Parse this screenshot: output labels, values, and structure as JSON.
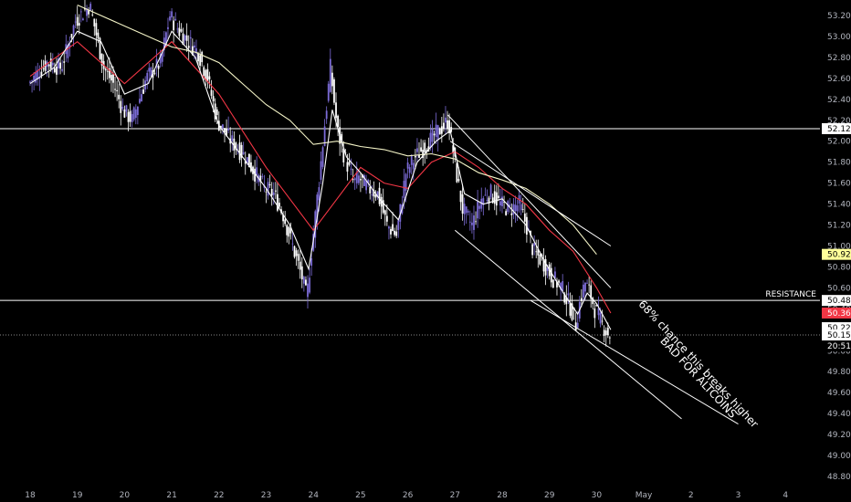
{
  "chart_data": {
    "type": "line",
    "title": "",
    "xlabel": "",
    "ylabel": "",
    "ylim": [
      48.7,
      53.34
    ],
    "x_ticks": [
      "18",
      "19",
      "20",
      "21",
      "22",
      "23",
      "24",
      "25",
      "26",
      "27",
      "28",
      "29",
      "30",
      "May",
      "2",
      "3",
      "4"
    ],
    "y_ticks": [
      "53.20",
      "53.00",
      "52.80",
      "52.60",
      "52.40",
      "52.20",
      "52.00",
      "51.80",
      "51.60",
      "51.40",
      "51.20",
      "51.00",
      "50.80",
      "50.60",
      "50.40",
      "50.20",
      "50.00",
      "49.80",
      "49.60",
      "49.40",
      "49.20",
      "49.00",
      "48.80"
    ],
    "price_path": [
      [
        18.0,
        52.55
      ],
      [
        18.4,
        52.75
      ],
      [
        18.7,
        52.7
      ],
      [
        19.0,
        53.15
      ],
      [
        19.3,
        53.3
      ],
      [
        19.6,
        52.7
      ],
      [
        19.8,
        52.55
      ],
      [
        20.0,
        52.3
      ],
      [
        20.2,
        52.2
      ],
      [
        20.5,
        52.6
      ],
      [
        20.8,
        52.75
      ],
      [
        21.0,
        53.2
      ],
      [
        21.2,
        53.05
      ],
      [
        21.4,
        52.95
      ],
      [
        21.6,
        52.85
      ],
      [
        21.8,
        52.6
      ],
      [
        22.0,
        52.2
      ],
      [
        22.3,
        52.0
      ],
      [
        22.6,
        51.85
      ],
      [
        22.8,
        51.7
      ],
      [
        23.0,
        51.55
      ],
      [
        23.2,
        51.5
      ],
      [
        23.4,
        51.3
      ],
      [
        23.6,
        51.0
      ],
      [
        23.8,
        50.7
      ],
      [
        23.9,
        50.5
      ],
      [
        24.0,
        50.95
      ],
      [
        24.2,
        51.8
      ],
      [
        24.4,
        52.7
      ],
      [
        24.55,
        52.1
      ],
      [
        24.7,
        51.85
      ],
      [
        24.9,
        51.6
      ],
      [
        25.0,
        51.65
      ],
      [
        25.2,
        51.55
      ],
      [
        25.4,
        51.5
      ],
      [
        25.6,
        51.2
      ],
      [
        25.8,
        51.1
      ],
      [
        26.0,
        51.7
      ],
      [
        26.2,
        51.85
      ],
      [
        26.4,
        51.95
      ],
      [
        26.6,
        52.05
      ],
      [
        26.8,
        52.15
      ],
      [
        26.9,
        52.2
      ],
      [
        27.05,
        51.75
      ],
      [
        27.2,
        51.35
      ],
      [
        27.4,
        51.2
      ],
      [
        27.6,
        51.45
      ],
      [
        27.8,
        51.5
      ],
      [
        28.0,
        51.4
      ],
      [
        28.2,
        51.35
      ],
      [
        28.4,
        51.4
      ],
      [
        28.55,
        51.2
      ],
      [
        28.7,
        50.95
      ],
      [
        28.9,
        50.85
      ],
      [
        29.1,
        50.7
      ],
      [
        29.3,
        50.6
      ],
      [
        29.5,
        50.4
      ],
      [
        29.6,
        50.25
      ],
      [
        29.7,
        50.5
      ],
      [
        29.8,
        50.65
      ],
      [
        29.9,
        50.55
      ],
      [
        30.0,
        50.4
      ],
      [
        30.1,
        50.3
      ],
      [
        30.2,
        50.22
      ],
      [
        30.3,
        50.15
      ]
    ],
    "series": [
      {
        "name": "",
        "color": "#f23645",
        "values": [
          [
            18.0,
            52.62
          ],
          [
            19.0,
            52.95
          ],
          [
            20.0,
            52.55
          ],
          [
            21.0,
            52.95
          ],
          [
            22.0,
            52.45
          ],
          [
            22.5,
            52.1
          ],
          [
            23.0,
            51.75
          ],
          [
            23.5,
            51.45
          ],
          [
            24.0,
            51.15
          ],
          [
            24.5,
            51.45
          ],
          [
            25.0,
            51.75
          ],
          [
            25.5,
            51.6
          ],
          [
            26.0,
            51.55
          ],
          [
            26.5,
            51.8
          ],
          [
            27.0,
            51.9
          ],
          [
            27.5,
            51.75
          ],
          [
            28.0,
            51.55
          ],
          [
            28.5,
            51.4
          ],
          [
            29.0,
            51.15
          ],
          [
            29.5,
            50.95
          ],
          [
            30.0,
            50.6
          ],
          [
            30.3,
            50.36
          ]
        ]
      },
      {
        "name": "",
        "color": "#f5f5c8",
        "values": [
          [
            19.0,
            53.3
          ],
          [
            20.0,
            53.1
          ],
          [
            21.0,
            52.9
          ],
          [
            21.5,
            52.85
          ],
          [
            22.0,
            52.75
          ],
          [
            22.5,
            52.55
          ],
          [
            23.0,
            52.35
          ],
          [
            23.5,
            52.2
          ],
          [
            24.0,
            51.97
          ],
          [
            24.5,
            52.0
          ],
          [
            25.0,
            51.95
          ],
          [
            25.5,
            51.92
          ],
          [
            26.0,
            51.86
          ],
          [
            26.5,
            51.88
          ],
          [
            27.0,
            51.83
          ],
          [
            27.5,
            51.7
          ],
          [
            28.0,
            51.63
          ],
          [
            28.5,
            51.55
          ],
          [
            29.0,
            51.4
          ],
          [
            29.5,
            51.2
          ],
          [
            30.0,
            50.92
          ]
        ]
      },
      {
        "name": "",
        "color": "#ffffff",
        "values": [
          [
            18.0,
            52.55
          ],
          [
            18.5,
            52.7
          ],
          [
            19.0,
            53.05
          ],
          [
            19.5,
            52.95
          ],
          [
            20.0,
            52.45
          ],
          [
            20.5,
            52.55
          ],
          [
            21.0,
            53.05
          ],
          [
            21.5,
            52.8
          ],
          [
            22.0,
            52.15
          ],
          [
            22.5,
            51.85
          ],
          [
            23.0,
            51.55
          ],
          [
            23.5,
            51.2
          ],
          [
            23.9,
            50.78
          ],
          [
            24.2,
            51.6
          ],
          [
            24.4,
            52.3
          ],
          [
            24.7,
            51.85
          ],
          [
            25.0,
            51.7
          ],
          [
            25.4,
            51.45
          ],
          [
            25.8,
            51.25
          ],
          [
            26.2,
            51.8
          ],
          [
            26.6,
            52.0
          ],
          [
            26.9,
            52.1
          ],
          [
            27.2,
            51.5
          ],
          [
            27.6,
            51.4
          ],
          [
            28.0,
            51.45
          ],
          [
            28.5,
            51.2
          ],
          [
            28.9,
            50.85
          ],
          [
            29.3,
            50.55
          ],
          [
            29.6,
            50.35
          ],
          [
            29.8,
            50.55
          ],
          [
            30.0,
            50.45
          ],
          [
            30.3,
            50.2
          ]
        ]
      }
    ],
    "horizontal_lines": [
      {
        "price": 52.12,
        "label": "52.12"
      },
      {
        "price": 50.48,
        "label": "50.48",
        "annotation": "RESISTANCE"
      }
    ],
    "current_line": {
      "price": 50.15
    },
    "price_tags": [
      {
        "value": "52.12",
        "price": 52.12,
        "bg": "#ffffff",
        "fg": "#000000"
      },
      {
        "value": "50.92",
        "price": 50.92,
        "bg": "#ffff99",
        "fg": "#000000"
      },
      {
        "value": "50.48",
        "price": 50.48,
        "bg": "#ffffff",
        "fg": "#000000"
      },
      {
        "value": "50.36",
        "price": 50.36,
        "bg": "#f23645",
        "fg": "#ffffff"
      },
      {
        "value": "50.22",
        "price": 50.22,
        "bg": "#ffffff",
        "fg": "#000000"
      },
      {
        "value": "50.15",
        "price": 50.15,
        "bg": "#ffffff",
        "fg": "#000000"
      }
    ],
    "countdown": "20:51",
    "channel_lines": [
      {
        "from": [
          26.85,
          52.25
        ],
        "to": [
          30.3,
          50.6
        ]
      },
      {
        "from": [
          26.9,
          52.0
        ],
        "to": [
          30.3,
          51.0
        ]
      },
      {
        "from": [
          27.0,
          51.15
        ],
        "to": [
          31.8,
          49.35
        ]
      },
      {
        "from": [
          28.6,
          50.48
        ],
        "to": [
          33.0,
          49.3
        ]
      }
    ],
    "annotations": [
      {
        "text": "68% chance this breaks higher",
        "at": [
          32.1,
          49.85
        ],
        "angle": 47
      },
      {
        "text": "BAD FOR ALTCOINS",
        "at": [
          32.1,
          49.72
        ],
        "angle": 47
      }
    ],
    "grid": false,
    "legend": "none",
    "colors": {
      "background": "#000000",
      "axis_text": "#b2b5be",
      "bull": "#7b6bd6",
      "bear": "#ffffff"
    }
  }
}
